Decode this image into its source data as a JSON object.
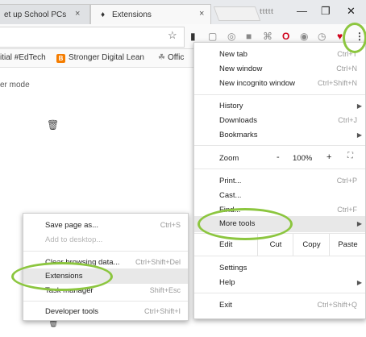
{
  "tabs": [
    {
      "label": "et up School PCs",
      "close": "×"
    },
    {
      "label": "Extensions",
      "close": "×"
    }
  ],
  "user_chip": "ttttt",
  "window_controls": {
    "minimize": "—",
    "maximize": "❐",
    "close": "✕"
  },
  "toolbar_icons": [
    "star-icon",
    "extension-icon",
    "pin-icon",
    "camera-icon",
    "stop-icon",
    "opera-icon",
    "clock-icon",
    "pocket-icon"
  ],
  "bookmarks": [
    {
      "label": "itial #EdTech"
    },
    {
      "label": "Stronger Digital Lean"
    },
    {
      "label": "Offic"
    }
  ],
  "page": {
    "dev_mode_label": "er mode"
  },
  "main_menu": {
    "new_tab": "New tab",
    "new_tab_shortcut": "Ctrl+T",
    "new_window": "New window",
    "new_window_shortcut": "Ctrl+N",
    "new_incognito": "New incognito window",
    "new_incognito_shortcut": "Ctrl+Shift+N",
    "history": "History",
    "downloads": "Downloads",
    "downloads_shortcut": "Ctrl+J",
    "bookmarks": "Bookmarks",
    "zoom": "Zoom",
    "zoom_minus": "-",
    "zoom_value": "100%",
    "zoom_plus": "+",
    "print": "Print...",
    "print_shortcut": "Ctrl+P",
    "cast": "Cast...",
    "find": "Find...",
    "find_shortcut": "Ctrl+F",
    "more_tools": "More tools",
    "edit": "Edit",
    "cut": "Cut",
    "copy": "Copy",
    "paste": "Paste",
    "settings": "Settings",
    "help": "Help",
    "exit": "Exit",
    "exit_shortcut": "Ctrl+Shift+Q"
  },
  "more_tools_menu": {
    "save_page": "Save page as...",
    "save_page_shortcut": "Ctrl+S",
    "add_to_desktop": "Add to desktop...",
    "clear_browsing": "Clear browsing data...",
    "clear_browsing_shortcut": "Ctrl+Shift+Del",
    "extensions": "Extensions",
    "task_manager": "Task manager",
    "task_manager_shortcut": "Shift+Esc",
    "developer_tools": "Developer tools",
    "developer_tools_shortcut": "Ctrl+Shift+I"
  },
  "colors": {
    "annotation": "#8cc63f",
    "highlight": "#e8e8e8",
    "opera_red": "#d0021b"
  }
}
